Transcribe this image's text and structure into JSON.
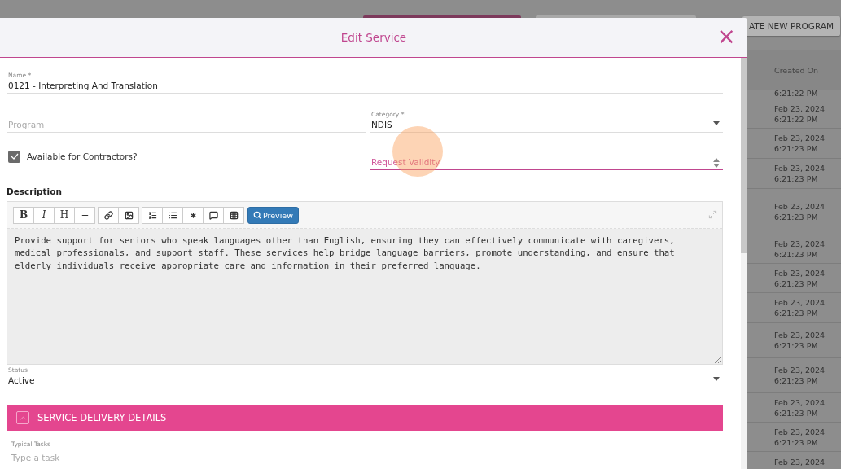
{
  "background": {
    "create_button": "ATE NEW PROGRAM",
    "column_header": "Created On",
    "rows": [
      {
        "time": "6:21:22 PM"
      },
      {
        "date": "Feb 23, 2024",
        "time": "6:21:22 PM"
      },
      {
        "date": "Feb 23, 2024",
        "time": "6:21:23 PM"
      },
      {
        "date": "Feb 23, 2024",
        "time": "6:21:23 PM"
      },
      {
        "date": "Feb 23, 2024",
        "time": "6:21:23 PM"
      },
      {
        "date": "Feb 23, 2024",
        "time": "6:21:23 PM"
      },
      {
        "date": "Feb 23, 2024",
        "time": "6:21:23 PM"
      },
      {
        "date": "Feb 23, 2024",
        "time": "6:21:23 PM"
      },
      {
        "date": "Feb 23, 2024",
        "time": "6:21:23 PM"
      },
      {
        "date": "Feb 23, 2024",
        "time": "6:21:23 PM"
      },
      {
        "date": "Feb 23, 2024",
        "time": "6:21:23 PM"
      },
      {
        "date": "Feb 23, 2024",
        "time": "6:21:23 PM"
      },
      {
        "date": "Feb 23, 2024"
      }
    ]
  },
  "dialog": {
    "title": "Edit Service",
    "close": "×",
    "name": {
      "label": "Name *",
      "value": "0121 - Interpreting And Translation"
    },
    "program": {
      "placeholder": "Program"
    },
    "category": {
      "label": "Category *",
      "value": "NDIS"
    },
    "available_for_contractors": {
      "label": "Available for Contractors?",
      "checked": true
    },
    "request_validity": {
      "placeholder": "Request Validity",
      "focused": true
    },
    "description": {
      "label": "Description",
      "toolbar": [
        {
          "kind": "bold",
          "label": "B"
        },
        {
          "kind": "italic",
          "label": "I"
        },
        {
          "kind": "heading",
          "label": "H"
        },
        {
          "kind": "rule"
        },
        {
          "kind": "link"
        },
        {
          "kind": "image"
        },
        {
          "kind": "ordered"
        },
        {
          "kind": "list"
        },
        {
          "kind": "asterisk"
        },
        {
          "kind": "comment"
        },
        {
          "kind": "grid"
        }
      ],
      "preview": "Preview",
      "text": "Provide support for seniors who speak languages other than English, ensuring they can effectively communicate with caregivers, medical professionals, and support staff. These services help bridge language barriers, promote understanding, and ensure that elderly individuals receive appropriate care and information in their preferred language."
    },
    "status": {
      "label": "Status",
      "value": "Active"
    },
    "section": {
      "title": "SERVICE DELIVERY DETAILS",
      "expanded": true
    },
    "typical_tasks": {
      "label": "Typical Tasks",
      "placeholder": "Type a task"
    }
  }
}
